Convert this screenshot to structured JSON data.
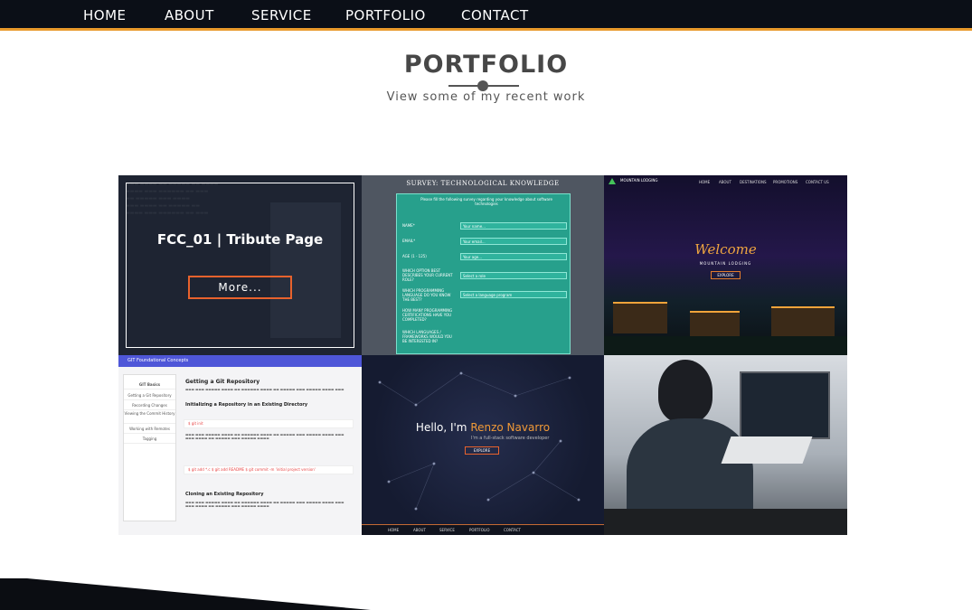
{
  "nav": {
    "items": [
      "HOME",
      "ABOUT",
      "SERVICE",
      "PORTFOLIO",
      "CONTACT"
    ]
  },
  "section": {
    "title": "PORTFOLIO",
    "subtitle": "View some of my recent work"
  },
  "portfolio": {
    "tiles": [
      {
        "name": "tribute-page",
        "overlay_title": "FCC_01 | Tribute Page",
        "more_label": "More..."
      },
      {
        "name": "survey-form",
        "title": "SURVEY: TECHNOLOGICAL KNOWLEDGE",
        "intro": "Please fill the following survey regarding your knowledge about software technologies",
        "fields": [
          "NAME*",
          "EMAIL*",
          "AGE (1 - 125)",
          "WHICH OPTION BEST DESCRIBES YOUR CURRENT ROLE?",
          "WHICH PROGRAMMING LANGUAGE DO YOU KNOW THE BEST?",
          "HOW MANY PROGRAMMING CERTIFICATIONS HAVE YOU COMPLETED?",
          "WHICH LANGUAGES / FRAMEWORKS WOULD YOU BE INTERESTED IN?"
        ],
        "placeholders": [
          "Your name...",
          "Your email...",
          "Your age...",
          "Select a role",
          "Select a language program"
        ]
      },
      {
        "name": "mountain-lodging",
        "logo": "MOUNTAIN LODGING",
        "links": [
          "HOME",
          "ABOUT",
          "DESTINATIONS",
          "PROMOTIONS",
          "CONTACT US"
        ],
        "welcome": "Welcome",
        "subtitle": "MOUNTAIN LODGING",
        "button": "EXPLORE"
      },
      {
        "name": "git-docs",
        "header": "GIT Foundational Concepts",
        "sidebar": [
          "GIT Basics",
          "Getting a Git Repository",
          "Recording Changes",
          "Viewing the Commit History",
          "Working with Remotes",
          "Tagging"
        ],
        "headings": [
          "Getting a Git Repository",
          "Initializing a Repository in an Existing Directory",
          "Cloning an Existing Repository"
        ],
        "code": [
          "$ git init",
          "$ git add *.c  $ git add README  $ git commit -m 'initial project version'"
        ]
      },
      {
        "name": "hello-landing",
        "hello": "Hello, I'm ",
        "name_text": "Renzo Navarro",
        "tagline": "I'm a full-stack software developer",
        "button": "EXPLORE",
        "nav": [
          "HOME",
          "ABOUT",
          "SERVICE",
          "PORTFOLIO",
          "CONTACT"
        ]
      },
      {
        "name": "developer-photo"
      }
    ]
  },
  "colors": {
    "navbar": "#0b0f17",
    "accent": "#e99a2c",
    "button_border": "#e8622d",
    "survey_green": "#27a08c",
    "git_blue": "#4e56d8"
  }
}
